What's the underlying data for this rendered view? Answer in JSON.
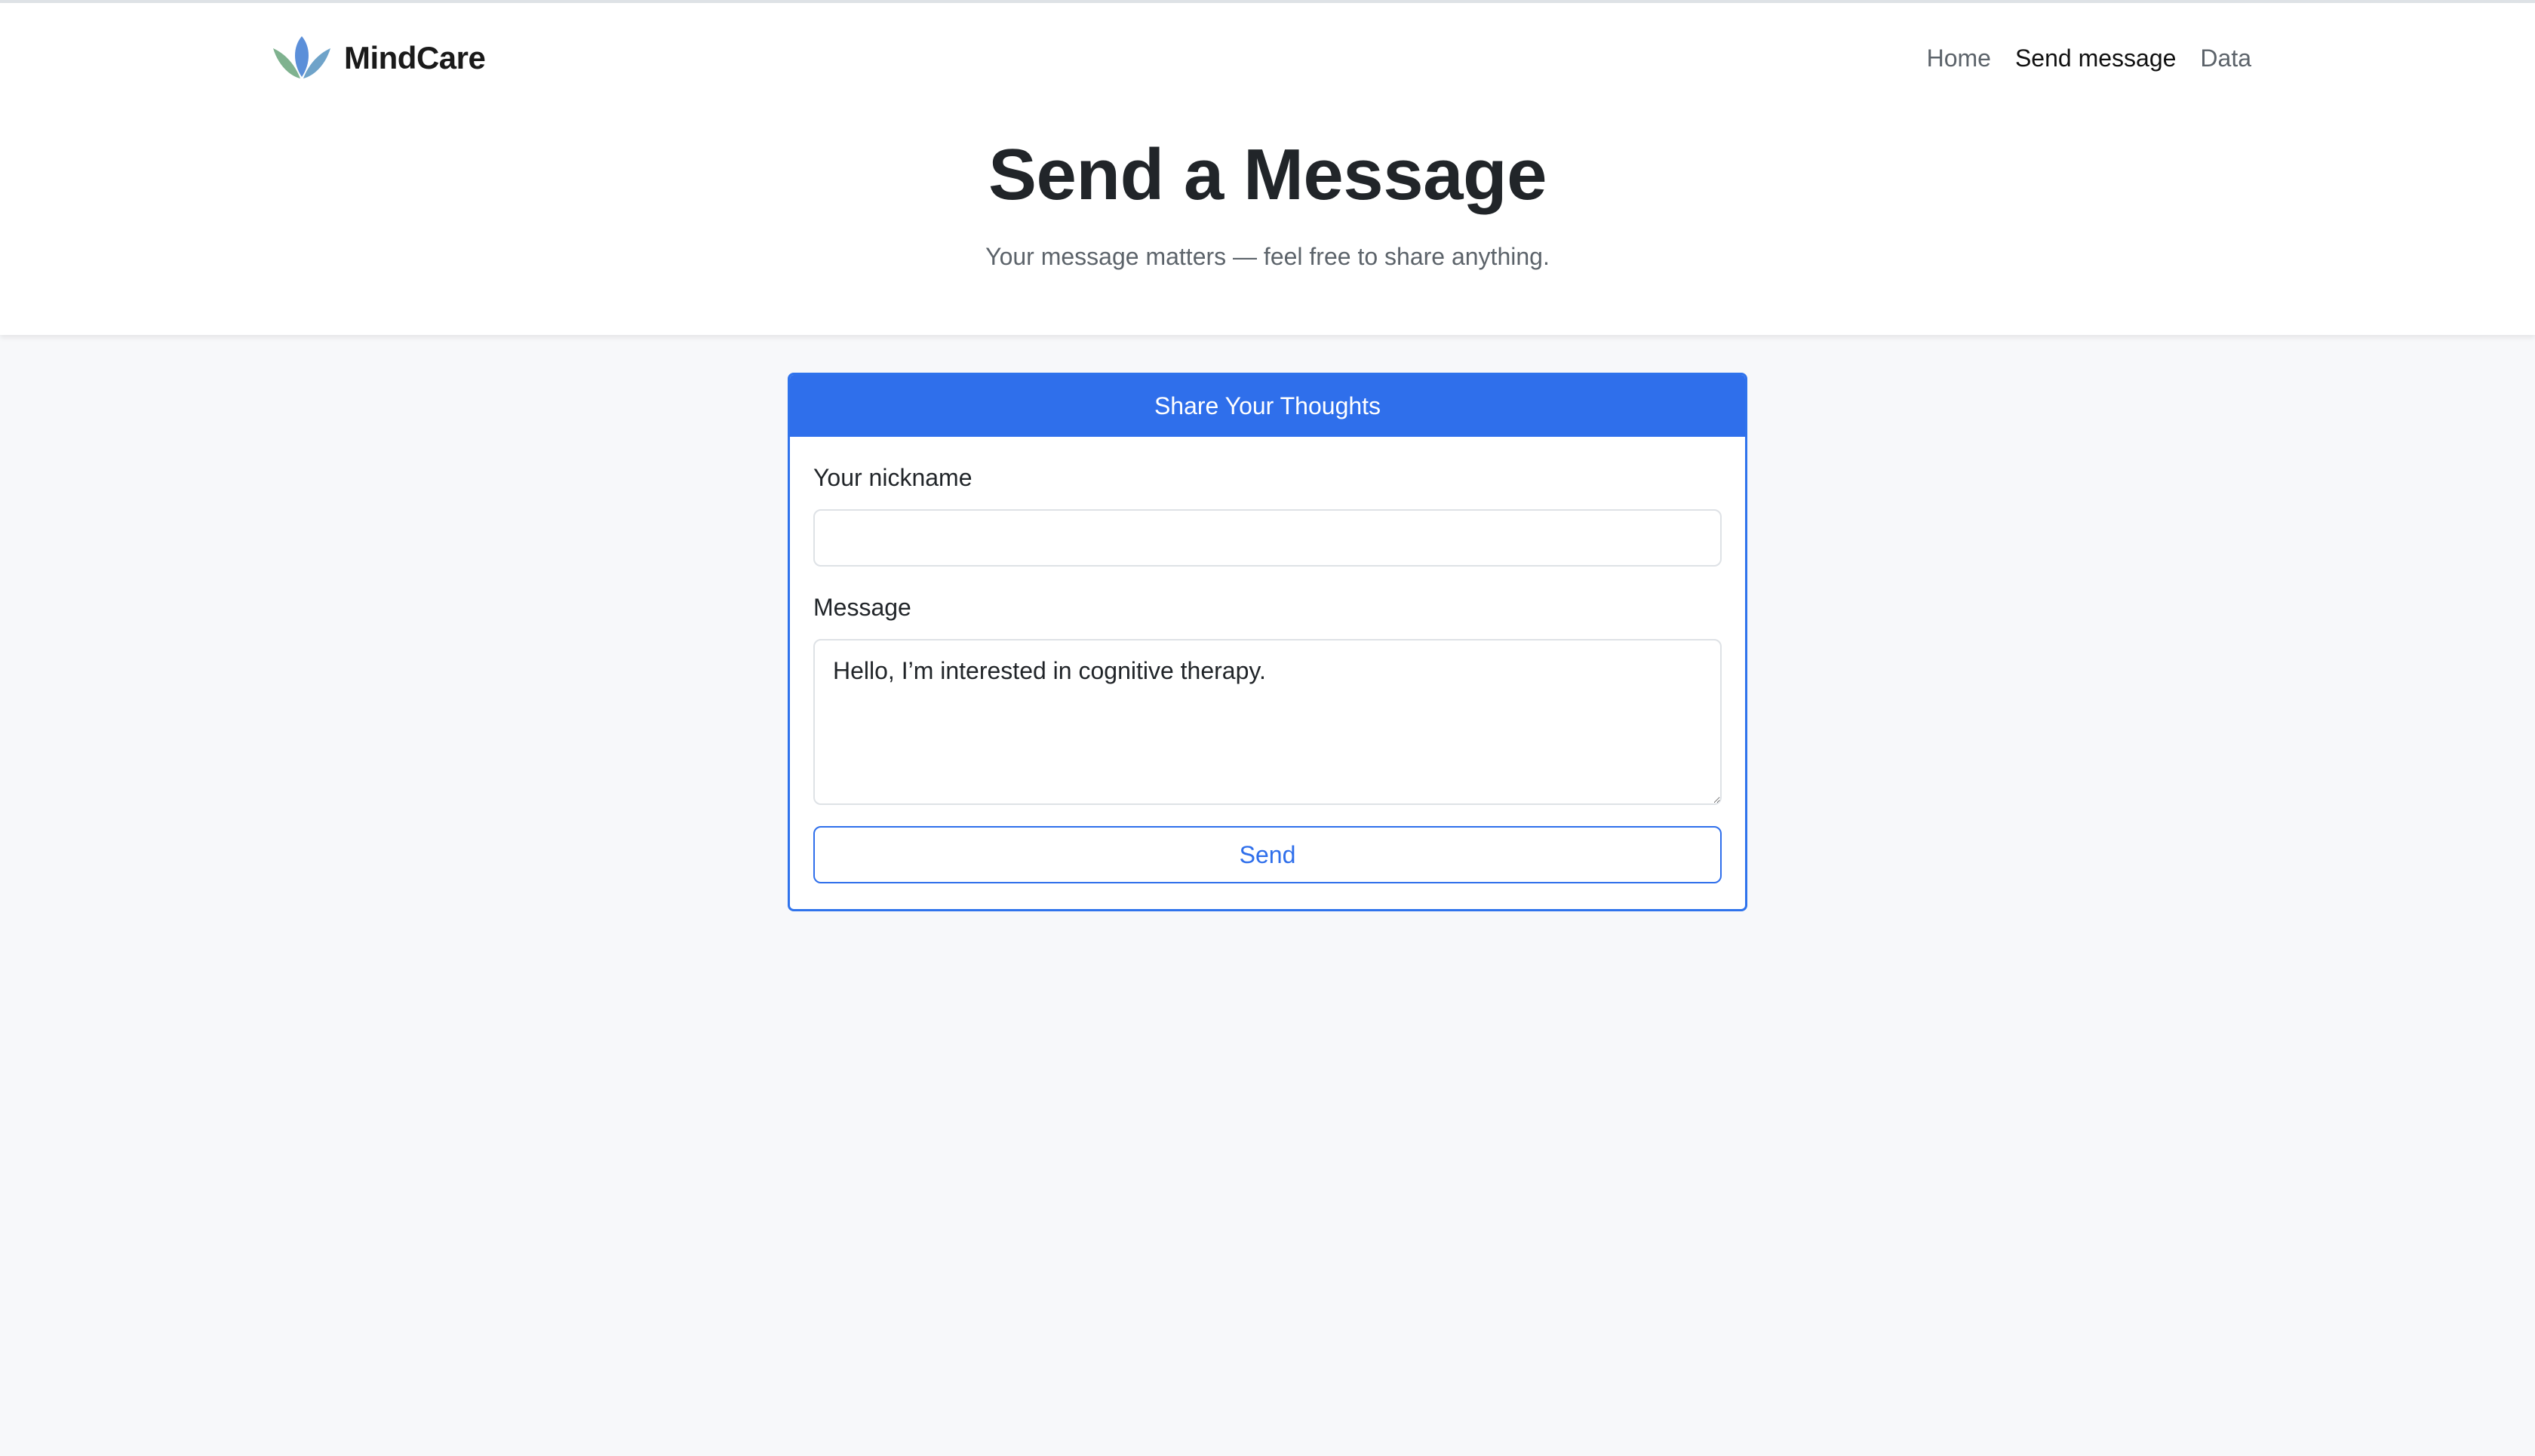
{
  "brand": {
    "name": "MindCare",
    "logo_icon": "lotus-icon"
  },
  "nav": {
    "items": [
      {
        "label": "Home",
        "active": false
      },
      {
        "label": "Send message",
        "active": true
      },
      {
        "label": "Data",
        "active": false
      }
    ]
  },
  "hero": {
    "title": "Send a Message",
    "subtitle": "Your message matters — feel free to share anything."
  },
  "form": {
    "card_title": "Share Your Thoughts",
    "nickname_label": "Your nickname",
    "nickname_value": "",
    "message_label": "Message",
    "message_value": "Hello, I’m interested in cognitive therapy.",
    "send_label": "Send"
  },
  "colors": {
    "accent": "#2f6feb",
    "page_background": "#f7f8fa",
    "header_background": "#ffffff"
  }
}
